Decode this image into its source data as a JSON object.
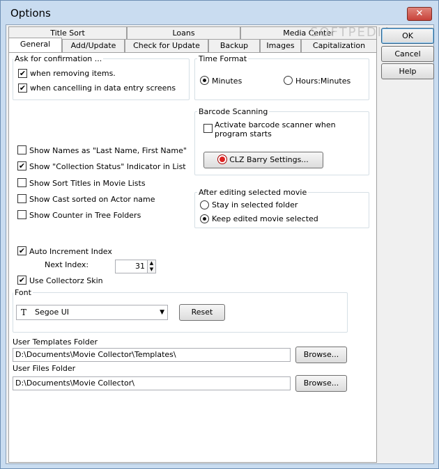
{
  "window": {
    "title": "Options",
    "close_glyph": "✕"
  },
  "tabs": {
    "row1": [
      "Title Sort",
      "Loans",
      "Media Center"
    ],
    "row2": [
      "General",
      "Add/Update",
      "Check for Update",
      "Backup",
      "Images",
      "Capitalization"
    ],
    "active": "General"
  },
  "buttons": {
    "ok": "OK",
    "cancel": "Cancel",
    "help": "Help"
  },
  "confirm": {
    "legend": "Ask for confirmation ...",
    "removing": {
      "label": "when removing items.",
      "checked": true
    },
    "cancelling": {
      "label": "when cancelling in data entry screens",
      "checked": true
    }
  },
  "time_format": {
    "legend": "Time Format",
    "minutes": {
      "label": "Minutes",
      "selected": true
    },
    "hours_minutes": {
      "label": "Hours:Minutes",
      "selected": false
    }
  },
  "options": [
    {
      "label": "Show Names as \"Last Name, First Name\"",
      "checked": false
    },
    {
      "label": "Show \"Collection Status\" Indicator in List",
      "checked": true
    },
    {
      "label": "Show Sort Titles in Movie Lists",
      "checked": false
    },
    {
      "label": "Show Cast sorted on Actor name",
      "checked": false
    },
    {
      "label": "Show Counter in Tree Folders",
      "checked": false
    }
  ],
  "barcode": {
    "legend": "Barcode Scanning",
    "activate_line1": "Activate barcode scanner when",
    "activate_line2": "program starts",
    "activate_checked": false,
    "settings_button": "CLZ Barry Settings..."
  },
  "after_edit": {
    "legend": "After editing selected movie",
    "stay": {
      "label": "Stay in selected folder",
      "selected": false
    },
    "keep": {
      "label": "Keep edited movie selected",
      "selected": true
    }
  },
  "auto_increment": {
    "label": "Auto Increment Index",
    "checked": true
  },
  "next_index": {
    "label": "Next Index:",
    "value": "31"
  },
  "collectorz_skin": {
    "label": "Use Collectorz Skin",
    "checked": true
  },
  "font": {
    "legend": "Font",
    "value": "Segoe UI",
    "reset_button": "Reset",
    "icon": "font-T-icon"
  },
  "templates_folder": {
    "label": "User Templates Folder",
    "value": "D:\\Documents\\Movie Collector\\Templates\\",
    "browse": "Browse..."
  },
  "files_folder": {
    "label": "User Files Folder",
    "value": "D:\\Documents\\Movie Collector\\",
    "browse": "Browse..."
  },
  "watermark": "SOFTPEDIA"
}
